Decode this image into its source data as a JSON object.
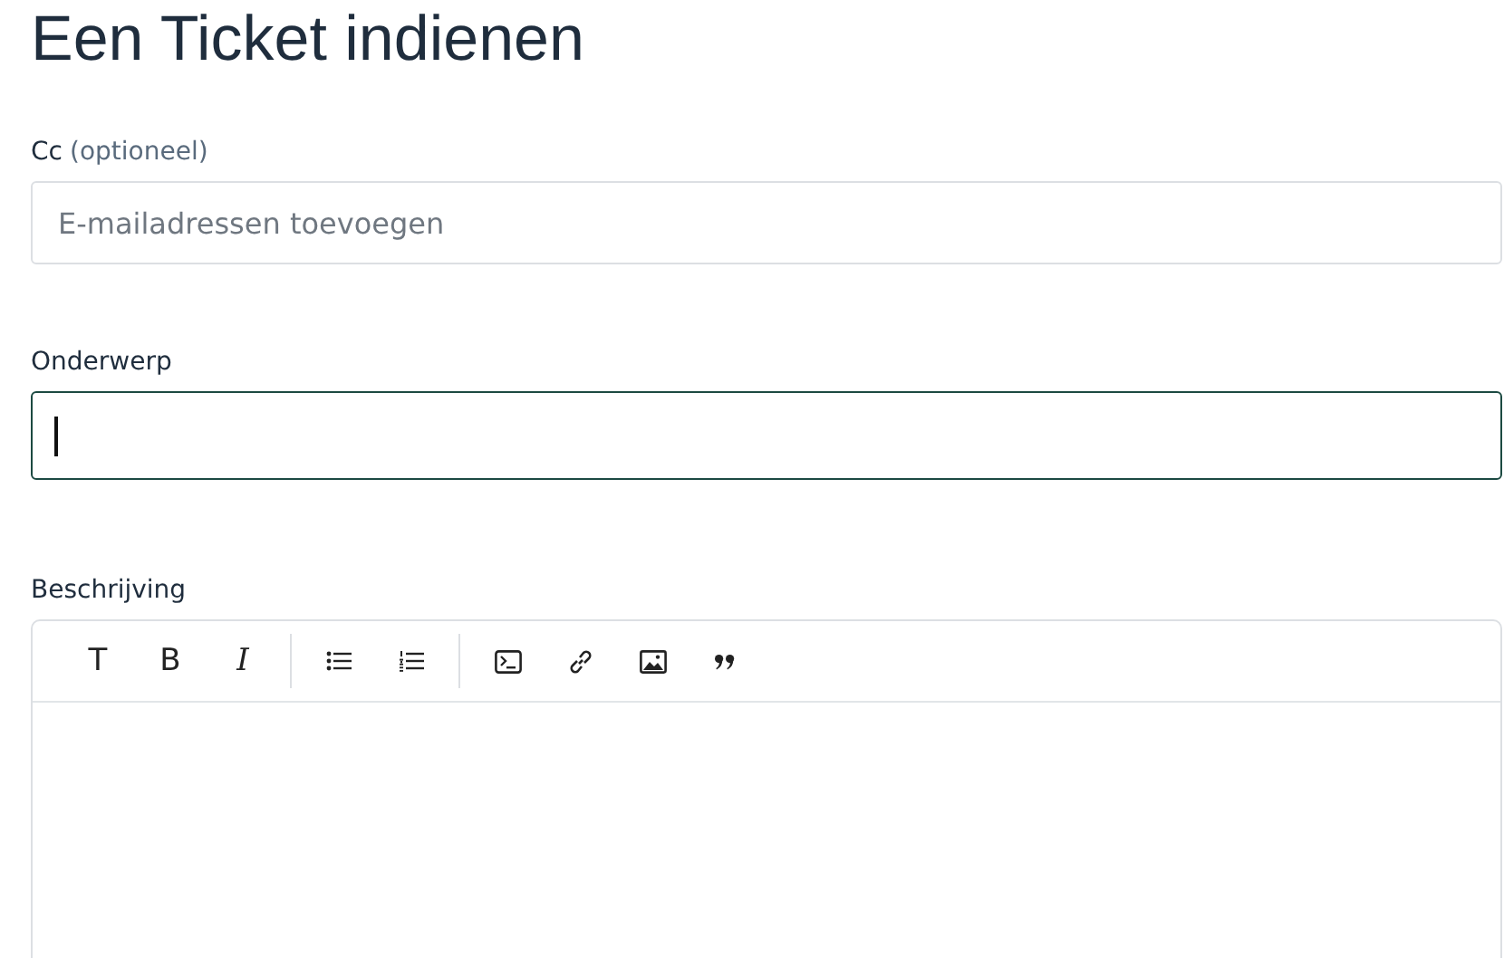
{
  "title": "Een Ticket indienen",
  "cc": {
    "label": "Cc",
    "hint": "(optioneel)",
    "placeholder": "E-mailadressen toevoegen",
    "focused": false
  },
  "subject": {
    "label": "Onderwerp",
    "focused": true
  },
  "description": {
    "label": "Beschrijving",
    "text_tools": [
      {
        "label": "T",
        "kind": "plain"
      },
      {
        "label": "B",
        "kind": "plain"
      },
      {
        "label": "I",
        "kind": "italic"
      }
    ]
  }
}
